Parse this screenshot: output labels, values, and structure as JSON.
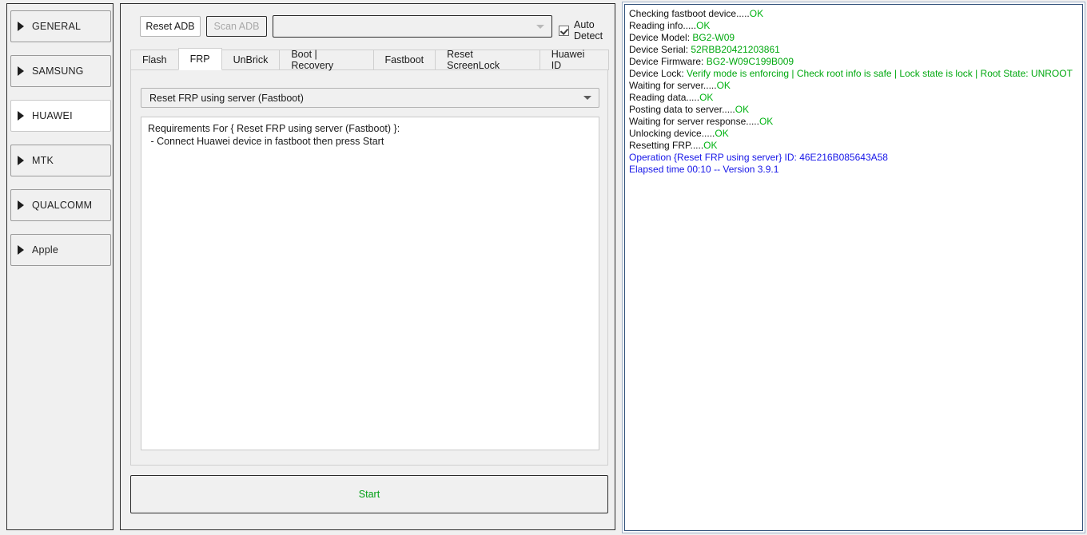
{
  "sidebar": {
    "items": [
      {
        "label": "GENERAL",
        "selected": false
      },
      {
        "label": "SAMSUNG",
        "selected": false
      },
      {
        "label": "HUAWEI",
        "selected": true
      },
      {
        "label": "MTK",
        "selected": false
      },
      {
        "label": "QUALCOMM",
        "selected": false
      },
      {
        "label": "Apple",
        "selected": false
      }
    ]
  },
  "toolbar": {
    "reset_adb_label": "Reset ADB",
    "scan_adb_label": "Scan ADB",
    "device_combo_value": "",
    "auto_detect_label": "Auto Detect",
    "auto_detect_checked": true
  },
  "tabs": [
    {
      "label": "Flash",
      "active": false
    },
    {
      "label": "FRP",
      "active": true
    },
    {
      "label": "UnBrick",
      "active": false
    },
    {
      "label": "Boot | Recovery",
      "active": false
    },
    {
      "label": "Fastboot",
      "active": false
    },
    {
      "label": "Reset ScreenLock",
      "active": false
    },
    {
      "label": "Huawei ID",
      "active": false
    }
  ],
  "operation": {
    "selected": "Reset FRP using server (Fastboot)",
    "requirements": "Requirements For { Reset FRP using server (Fastboot) }:\n - Connect Huawei device in fastboot then press Start"
  },
  "start_button": {
    "label": "Start",
    "color": "#00a014"
  },
  "log": {
    "lines": [
      {
        "parts": [
          {
            "t": "Checking fastboot device.....",
            "c": "plain"
          },
          {
            "t": "OK",
            "c": "ok"
          }
        ]
      },
      {
        "parts": [
          {
            "t": "Reading info.....",
            "c": "plain"
          },
          {
            "t": "OK",
            "c": "ok"
          }
        ]
      },
      {
        "parts": [
          {
            "t": "Device Model: ",
            "c": "plain"
          },
          {
            "t": "BG2-W09",
            "c": "info"
          }
        ]
      },
      {
        "parts": [
          {
            "t": "Device Serial: ",
            "c": "plain"
          },
          {
            "t": "52RBB20421203861",
            "c": "info"
          }
        ]
      },
      {
        "parts": [
          {
            "t": "Device Firmware: ",
            "c": "plain"
          },
          {
            "t": "BG2-W09C199B009",
            "c": "info"
          }
        ]
      },
      {
        "parts": [
          {
            "t": "Device Lock: ",
            "c": "plain"
          },
          {
            "t": "Verify mode is enforcing | Check root info is safe | Lock state is lock | Root State: UNROOT",
            "c": "info"
          }
        ]
      },
      {
        "parts": [
          {
            "t": "Waiting for server.....",
            "c": "plain"
          },
          {
            "t": "OK",
            "c": "ok"
          }
        ]
      },
      {
        "parts": [
          {
            "t": "Reading data.....",
            "c": "plain"
          },
          {
            "t": "OK",
            "c": "ok"
          }
        ]
      },
      {
        "parts": [
          {
            "t": "Posting data to server.....",
            "c": "plain"
          },
          {
            "t": "OK",
            "c": "ok"
          }
        ]
      },
      {
        "parts": [
          {
            "t": "Waiting for server response.....",
            "c": "plain"
          },
          {
            "t": "OK",
            "c": "ok"
          }
        ]
      },
      {
        "parts": [
          {
            "t": "Unlocking device.....",
            "c": "plain"
          },
          {
            "t": "OK",
            "c": "ok"
          }
        ]
      },
      {
        "parts": [
          {
            "t": "Resetting FRP.....",
            "c": "plain"
          },
          {
            "t": "OK",
            "c": "ok"
          }
        ]
      },
      {
        "parts": [
          {
            "t": "Operation {Reset FRP using server} ID: 46E216B085643A58",
            "c": "blue"
          }
        ]
      },
      {
        "parts": [
          {
            "t": "Elapsed time 00:10 -- Version 3.9.1",
            "c": "blue"
          }
        ]
      }
    ]
  }
}
